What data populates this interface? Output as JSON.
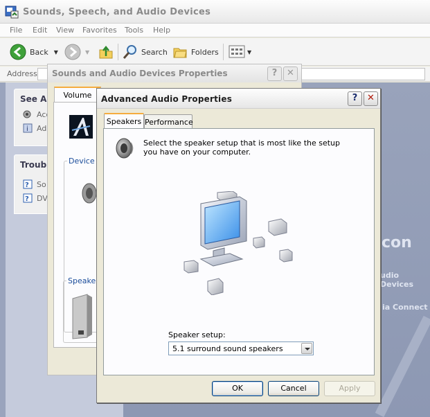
{
  "explorer": {
    "title": "Sounds, Speech, and Audio Devices",
    "menu": [
      "File",
      "Edit",
      "View",
      "Favorites",
      "Tools",
      "Help"
    ],
    "toolbar": {
      "back": "Back",
      "search": "Search",
      "folders": "Folders"
    },
    "address_label": "Address",
    "see_also": {
      "heading": "See Als",
      "items": [
        "Acc",
        "Ad"
      ]
    },
    "troubleshooters": {
      "heading": "Troubl",
      "items": [
        "So",
        "DV"
      ]
    },
    "right_fragments": {
      "con": "con",
      "audio_devices": "udio Devices",
      "media_connect": "ia Connect"
    }
  },
  "sounds_dialog": {
    "title": "Sounds and Audio Devices Properties",
    "tab": "Volume",
    "device_group": "Device",
    "speaker_group": "Speake"
  },
  "advanced_dialog": {
    "title": "Advanced Audio Properties",
    "tabs": [
      "Speakers",
      "Performance"
    ],
    "intro": "Select the speaker setup that is most like the setup you have on your computer.",
    "speaker_setup_label": "Speaker setup:",
    "speaker_setup_value": "5.1 surround sound speakers",
    "buttons": {
      "ok": "OK",
      "cancel": "Cancel",
      "apply": "Apply"
    }
  }
}
